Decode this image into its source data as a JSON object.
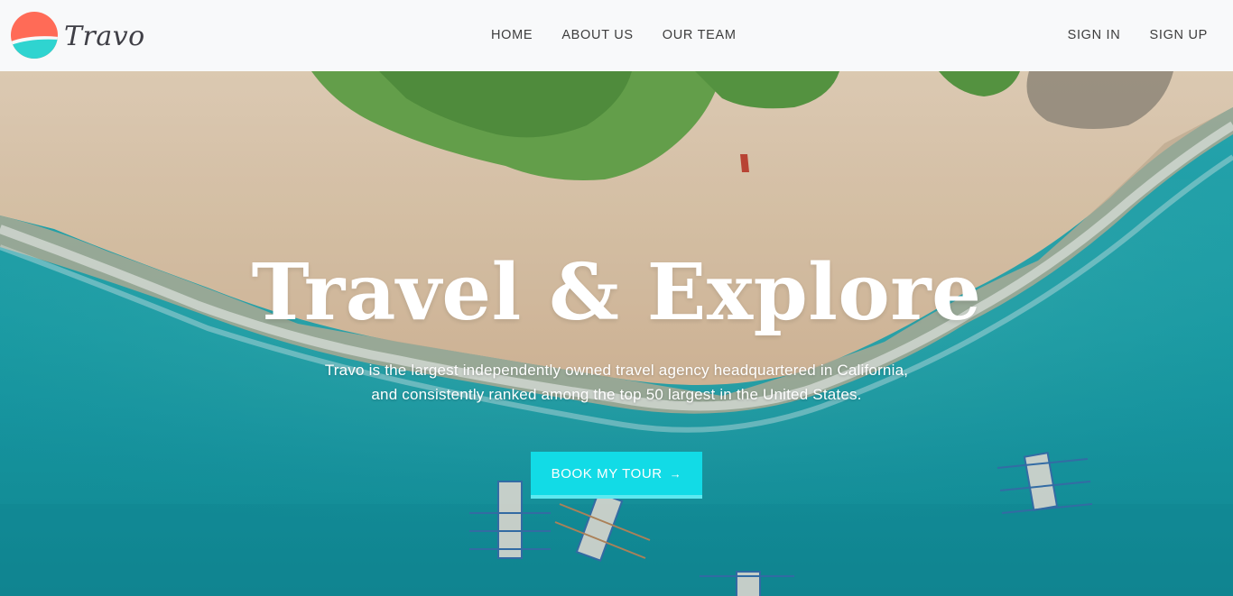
{
  "brand": {
    "name": "Travo",
    "colors": {
      "logo_top": "#ff6b57",
      "logo_bottom": "#2fd4d0",
      "accent": "#12dbe6"
    }
  },
  "nav": {
    "links": [
      {
        "label": "HOME"
      },
      {
        "label": "ABOUT US"
      },
      {
        "label": "OUR TEAM"
      }
    ],
    "auth": [
      {
        "label": "SIGN IN"
      },
      {
        "label": "SIGN UP"
      }
    ]
  },
  "hero": {
    "title": "Travel & Explore",
    "subtitle": "Travo is the largest independently owned travel agency headquartered in California, and consistently ranked among the top 50 largest in the United States.",
    "cta_label": "BOOK MY TOUR",
    "cta_icon": "arrow-right-icon",
    "background": "aerial-beach-photo"
  }
}
